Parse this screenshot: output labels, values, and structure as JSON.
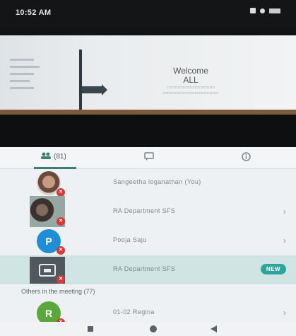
{
  "status_bar": {
    "time": "10:52 AM"
  },
  "shared_screen": {
    "slide_title_line1": "Welcome",
    "slide_title_line2": "ALL"
  },
  "tabs": {
    "people_label": "(81)"
  },
  "participants": [
    {
      "name": "Sangeetha loganathan (You)",
      "avatar_type": "photo"
    },
    {
      "name": "RA Department SFS",
      "avatar_type": "photo"
    },
    {
      "name": "Pooja Saju",
      "avatar_letter": "P",
      "avatar_color": "#1e8fd6"
    },
    {
      "name": "RA Department SFS",
      "avatar_type": "presenting",
      "badge": "NEW",
      "selected": true
    }
  ],
  "others": {
    "header": "Others in the meeting (77)",
    "items": [
      {
        "name": "01-02 Regina",
        "avatar_letter": "R",
        "avatar_color": "#5aa83b"
      }
    ]
  },
  "colors": {
    "accent": "#3b7f6e",
    "new_badge": "#2ba59a",
    "mic_muted": "#d43a3a"
  }
}
